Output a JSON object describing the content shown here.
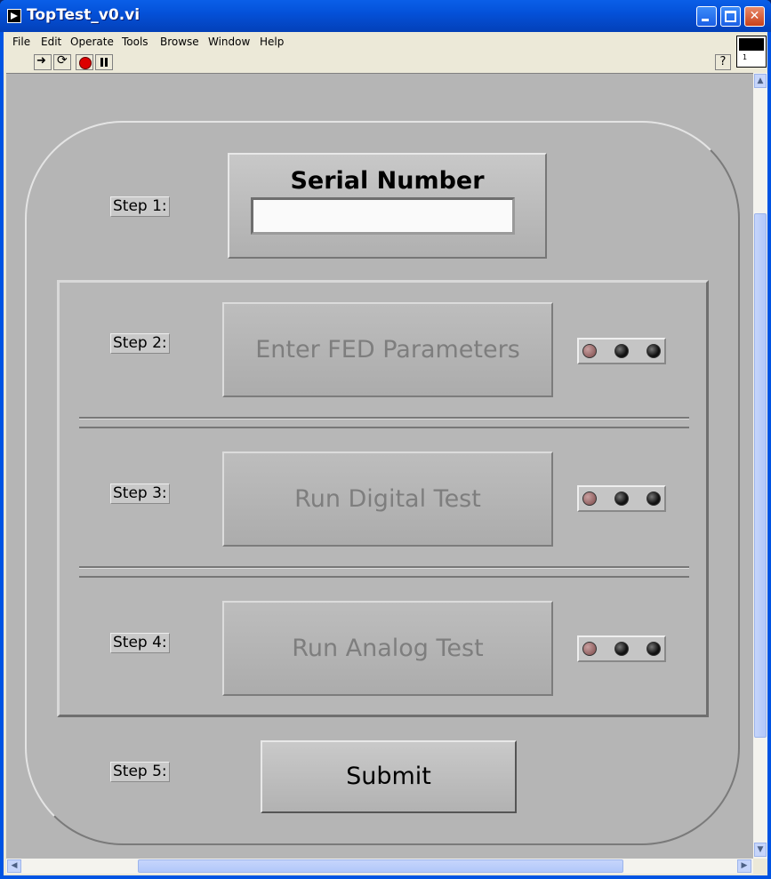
{
  "window": {
    "title": "TopTest_v0.vi"
  },
  "menu": {
    "items": [
      "File",
      "Edit",
      "Operate",
      "Tools",
      "Browse",
      "Window",
      "Help"
    ]
  },
  "toolbar": {
    "icons": [
      "run-arrow-icon",
      "run-continuously-icon",
      "abort-icon",
      "pause-icon"
    ],
    "help_label": "?"
  },
  "vi_icon": {
    "number": "1"
  },
  "panel": {
    "step1": {
      "label": "Step 1:",
      "title": "Serial Number",
      "value": ""
    },
    "step2": {
      "label": "Step 2:",
      "button": "Enter FED Parameters"
    },
    "step3": {
      "label": "Step 3:",
      "button": "Run Digital Test"
    },
    "step4": {
      "label": "Step 4:",
      "button": "Run Analog Test"
    },
    "step5": {
      "label": "Step 5:",
      "button": "Submit"
    }
  },
  "colors": {
    "panel_bg": "#b5b5b5",
    "title_bar": "#0451d9",
    "led_on": "#7a4848",
    "led_off": "#111111"
  }
}
